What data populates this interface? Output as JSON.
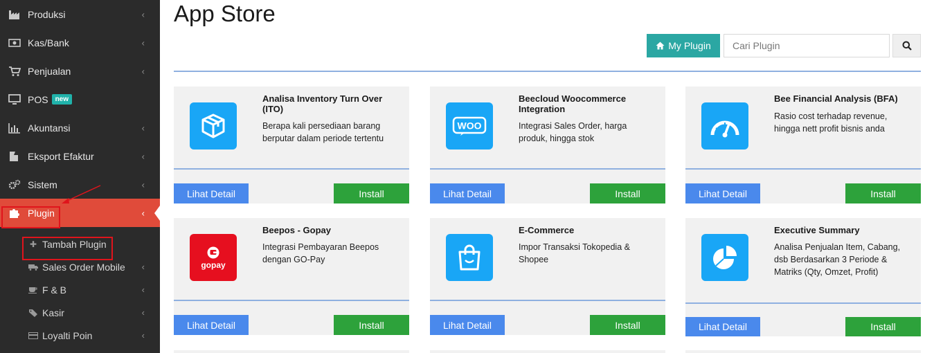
{
  "sidebar": {
    "items": [
      {
        "label": "Produksi",
        "icon": "factory-icon"
      },
      {
        "label": "Kas/Bank",
        "icon": "money-icon"
      },
      {
        "label": "Penjualan",
        "icon": "cart-icon"
      },
      {
        "label": "POS",
        "icon": "monitor-icon",
        "badge": "new"
      },
      {
        "label": "Akuntansi",
        "icon": "bar-chart-icon"
      },
      {
        "label": "Eksport Efaktur",
        "icon": "export-icon"
      },
      {
        "label": "Sistem",
        "icon": "gears-icon"
      },
      {
        "label": "Plugin",
        "icon": "puzzle-icon"
      }
    ],
    "sub_items": [
      {
        "label": "Tambah Plugin",
        "icon": "plus-icon"
      },
      {
        "label": "Sales Order Mobile",
        "icon": "truck-icon"
      },
      {
        "label": "F & B",
        "icon": "coffee-icon"
      },
      {
        "label": "Kasir",
        "icon": "tags-icon"
      },
      {
        "label": "Loyalti Poin",
        "icon": "credit-card-icon"
      }
    ],
    "colors": {
      "background": "#2b2b2b",
      "active": "#e04b3a",
      "highlight": "#e0141c"
    }
  },
  "header": {
    "title": "App Store",
    "my_plugin_label": "My Plugin",
    "search_placeholder": "Cari Plugin"
  },
  "cards": [
    {
      "title": "Analisa Inventory Turn Over (ITO)",
      "desc": "Berapa kali persediaan barang berputar dalam periode tertentu",
      "icon": "box-icon"
    },
    {
      "title": "Beecloud Woocommerce Integration",
      "desc": "Integrasi Sales Order, harga produk, hingga stok",
      "icon": "woo-icon"
    },
    {
      "title": "Bee Financial Analysis (BFA)",
      "desc": "Rasio cost terhadap revenue, hingga nett profit bisnis anda",
      "icon": "gauge-icon"
    },
    {
      "title": "Beepos - Gopay",
      "desc": "Integrasi Pembayaran Beepos dengan GO-Pay",
      "icon": "gopay-icon"
    },
    {
      "title": "E-Commerce",
      "desc": "Impor Transaksi Tokopedia & Shopee",
      "icon": "shopping-bag-icon"
    },
    {
      "title": "Executive Summary",
      "desc": "Analisa Penjualan Item, Cabang, dsb Berdasarkan 3 Periode & Matriks (Qty, Omzet, Profit)",
      "icon": "pie-chart-icon"
    }
  ],
  "card_buttons": {
    "detail": "Lihat Detail",
    "install": "Install"
  },
  "icon_text": {
    "woo": "WOO",
    "gopay": "gopay"
  },
  "colors": {
    "accent_teal": "#2ba7a3",
    "button_blue": "#4a89ec",
    "button_green": "#2da23b",
    "icon_blue": "#19a6f6",
    "gopay_red": "#e60f1f"
  }
}
